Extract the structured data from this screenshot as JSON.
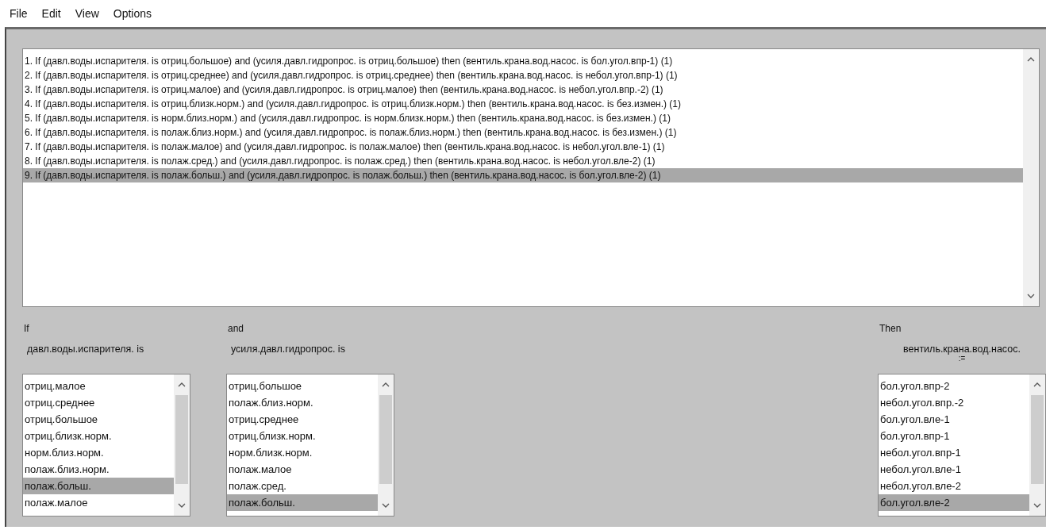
{
  "menu": [
    "File",
    "Edit",
    "View",
    "Options"
  ],
  "rules": [
    {
      "text": "1. If (давл.воды.испарителя. is отриц.большое) and (усиля.давл.гидропрос. is отриц.большое) then (вентиль.крана.вод.насос. is бол.угол.впр-1) (1)",
      "selected": false
    },
    {
      "text": "2. If (давл.воды.испарителя. is отриц.среднее) and (усиля.давл.гидропрос. is отриц.среднее) then (вентиль.крана.вод.насос. is небол.угол.впр-1) (1)",
      "selected": false
    },
    {
      "text": "3. If (давл.воды.испарителя. is отриц.малое) and (усиля.давл.гидропрос. is отриц.малое) then (вентиль.крана.вод.насос. is небол.угол.впр.-2) (1)",
      "selected": false
    },
    {
      "text": "4. If (давл.воды.испарителя. is отриц.близк.норм.) and (усиля.давл.гидропрос. is отриц.близк.норм.) then (вентиль.крана.вод.насос. is без.измен.) (1)",
      "selected": false
    },
    {
      "text": "5. If (давл.воды.испарителя. is норм.близ.норм.) and (усиля.давл.гидропрос. is норм.близк.норм.) then (вентиль.крана.вод.насос. is без.измен.) (1)",
      "selected": false
    },
    {
      "text": "6. If (давл.воды.испарителя. is полаж.близ.норм.) and (усиля.давл.гидропрос. is полаж.близ.норм.) then (вентиль.крана.вод.насос. is без.измен.) (1)",
      "selected": false
    },
    {
      "text": "7. If (давл.воды.испарителя. is полаж.малое) and (усиля.давл.гидропрос. is полаж.малое) then (вентиль.крана.вод.насос. is небол.угол.вле-1) (1)",
      "selected": false
    },
    {
      "text": "8. If (давл.воды.испарителя. is полаж.сред.) and (усиля.давл.гидропрос. is полаж.сред.) then (вентиль.крана.вод.насос. is небол.угол.вле-2) (1)",
      "selected": false
    },
    {
      "text": "9. If (давл.воды.испарителя. is полаж.больш.) and (усиля.давл.гидропрос. is полаж.больш.) then (вентиль.крана.вод.насос. is бол.угол.вле-2) (1)",
      "selected": true
    }
  ],
  "columns": [
    {
      "header": "If",
      "label": "давл.воды.испарителя. is",
      "items": [
        {
          "text": "отриц.малое",
          "selected": false
        },
        {
          "text": "отриц.среднее",
          "selected": false
        },
        {
          "text": "отриц.большое",
          "selected": false
        },
        {
          "text": "отриц.близк.норм.",
          "selected": false
        },
        {
          "text": "норм.близ.норм.",
          "selected": false
        },
        {
          "text": "полаж.близ.норм.",
          "selected": false
        },
        {
          "text": "полаж.больш.",
          "selected": true
        },
        {
          "text": "полаж.малое",
          "selected": false
        }
      ]
    },
    {
      "header": "and",
      "label": "усиля.давл.гидропрос. is",
      "items": [
        {
          "text": "отриц.большое",
          "selected": false
        },
        {
          "text": "полаж.близ.норм.",
          "selected": false
        },
        {
          "text": "отриц.среднее",
          "selected": false
        },
        {
          "text": "отриц.близк.норм.",
          "selected": false
        },
        {
          "text": "норм.близк.норм.",
          "selected": false
        },
        {
          "text": "полаж.малое",
          "selected": false
        },
        {
          "text": "полаж.сред.",
          "selected": false
        },
        {
          "text": "полаж.больш.",
          "selected": true
        }
      ]
    },
    {
      "header": "Then",
      "label": "вентиль.крана.вод.насос.",
      "sublabel": ":=",
      "items": [
        {
          "text": "бол.угол.впр-2",
          "selected": false
        },
        {
          "text": "небол.угол.впр.-2",
          "selected": false
        },
        {
          "text": "бол.угол.вле-1",
          "selected": false
        },
        {
          "text": "бол.угол.впр-1",
          "selected": false
        },
        {
          "text": "небол.угол.впр-1",
          "selected": false
        },
        {
          "text": "небол.угол.вле-1",
          "selected": false
        },
        {
          "text": "небол.угол.вле-2",
          "selected": false
        },
        {
          "text": "бол.угол.вле-2",
          "selected": true
        }
      ]
    }
  ]
}
